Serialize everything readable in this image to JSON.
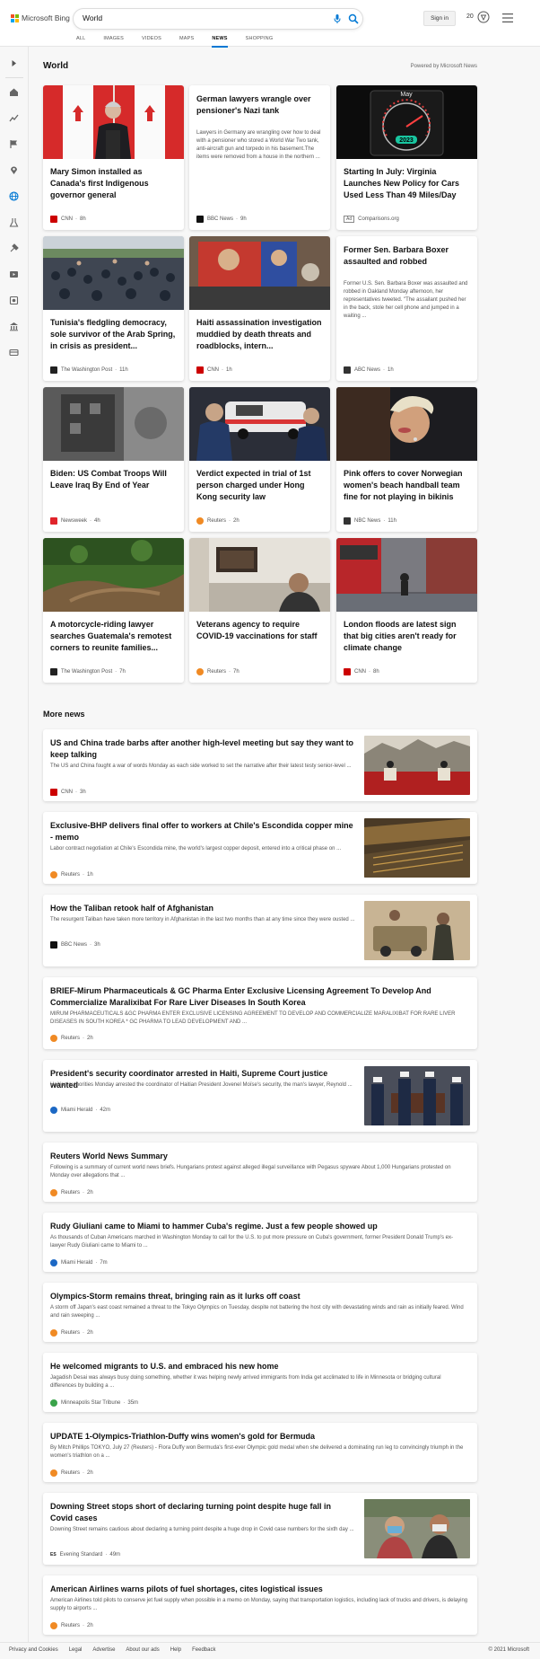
{
  "header": {
    "logo_text": "Microsoft Bing",
    "search_value": "World",
    "signin_label": "Sign in",
    "rewards_points": "20",
    "logo_colors": [
      "#f25022",
      "#7fba00",
      "#00a4ef",
      "#ffb900"
    ]
  },
  "nav": {
    "tabs": [
      {
        "label": "ALL"
      },
      {
        "label": "IMAGES"
      },
      {
        "label": "VIDEOS"
      },
      {
        "label": "MAPS"
      },
      {
        "label": "NEWS",
        "active": true
      },
      {
        "label": "SHOPPING"
      }
    ]
  },
  "sidebar": {
    "icons": [
      "expand-icon",
      "home-icon",
      "trending-icon",
      "flag-icon",
      "location-icon",
      "globe-icon",
      "science-icon",
      "technology-icon",
      "entertainment-icon",
      "sports-icon",
      "business-icon",
      "politics-icon"
    ]
  },
  "world": {
    "title": "World",
    "powered_by": "Powered by Microsoft News",
    "cards": [
      {
        "title": "Mary Simon installed as Canada's first Indigenous governor general",
        "source": "CNN",
        "time": "8h",
        "logo_color": "#cc0000"
      },
      {
        "title": "German lawyers wrangle over pensioner's Nazi tank",
        "snippet": "Lawyers in Germany are wrangling over how to deal with a pensioner who stored a World War Two tank, anti-aircraft gun and torpedo in his basement.The items were removed from a house in the northern ...",
        "source": "BBC News",
        "time": "9h",
        "logo_color": "#111111"
      },
      {
        "title": "Starting In July: Virginia Launches New Policy for Cars Used Less Than 49 Miles/Day",
        "source": "Comparisons.org",
        "time": "",
        "ad": "Ad",
        "image_month": "May",
        "image_year": "2023"
      },
      {
        "title": "Tunisia's fledgling democracy, sole survivor of the Arab Spring, in crisis as president...",
        "source": "The Washington Post",
        "time": "11h",
        "logo_color": "#222222"
      },
      {
        "title": "Haiti assassination investigation muddied by death threats and roadblocks, intern...",
        "source": "CNN",
        "time": "1h",
        "logo_color": "#cc0000"
      },
      {
        "title": "Former Sen. Barbara Boxer assaulted and robbed",
        "snippet": "Former U.S. Sen. Barbara Boxer was assaulted and robbed in Oakland Monday afternoon, her representatives tweeted. \"The assailant pushed her in the back, stole her cell phone and jumped in a waiting ...",
        "source": "ABC News",
        "time": "1h",
        "logo_color": "#333333"
      },
      {
        "title": "Biden: US Combat Troops Will Leave Iraq By End of Year",
        "source": "Newsweek",
        "time": "4h",
        "logo_color": "#e0242b"
      },
      {
        "title": "Verdict expected in trial of 1st person charged under Hong Kong security law",
        "source": "Reuters",
        "time": "2h",
        "logo_color": "#f08a24"
      },
      {
        "title": "Pink offers to cover Norwegian women's beach handball team fine for not playing in bikinis",
        "source": "NBC News",
        "time": "11h",
        "logo_color": "#333333"
      },
      {
        "title": "A motorcycle-riding lawyer searches Guatemala's remotest corners to reunite families...",
        "source": "The Washington Post",
        "time": "7h",
        "logo_color": "#222222"
      },
      {
        "title": "Veterans agency to require COVID-19 vaccinations for staff",
        "source": "Reuters",
        "time": "7h",
        "logo_color": "#f08a24"
      },
      {
        "title": "London floods are latest sign that big cities aren't ready for climate change",
        "source": "CNN",
        "time": "8h",
        "logo_color": "#cc0000"
      }
    ]
  },
  "more_news": {
    "title": "More news",
    "items": [
      {
        "title": "US and China trade barbs after another high-level meeting but say they want to keep talking",
        "snippet": "The US and China fought a war of words Monday as each side worked to set the narrative after their latest testy senior-level ...",
        "source": "CNN",
        "time": "3h",
        "logo_color": "#cc0000",
        "has_image": true
      },
      {
        "title": "Exclusive-BHP delivers final offer to workers at Chile's Escondida copper mine - memo",
        "snippet": "Labor contract negotiation at Chile's Escondida mine, the world's largest copper deposit, entered into a critical phase on ...",
        "source": "Reuters",
        "time": "1h",
        "logo_color": "#f08a24",
        "has_image": true
      },
      {
        "title": "How the Taliban retook half of Afghanistan",
        "snippet": "The resurgent Taliban have taken more territory in Afghanistan in the last two months than at any time since they were ousted ...",
        "source": "BBC News",
        "time": "3h",
        "logo_color": "#111111",
        "has_image": true
      },
      {
        "title": "BRIEF-Mirum Pharmaceuticals & GC Pharma Enter Exclusive Licensing Agreement To Develop And Commercialize Maralixibat For Rare Liver Diseases In South Korea",
        "snippet": "MIRUM PHARMACEUTICALS &GC PHARMA ENTER EXCLUSIVE LICENSING AGREEMENT TO DEVELOP AND COMMERCIALIZE MARALIXIBAT FOR RARE LIVER DISEASES IN SOUTH KOREA * GC PHARMA TO LEAD DEVELOPMENT AND ...",
        "source": "Reuters",
        "time": "2h",
        "logo_color": "#f08a24",
        "has_image": false
      },
      {
        "title": "President's security coordinator arrested in Haiti, Supreme Court justice wanted",
        "snippet": "Haitian authorities Monday arrested the coordinator of Haitian President Jovenel Moïse's security, the man's lawyer, Reynold ...",
        "source": "Miami Herald",
        "time": "42m",
        "logo_color": "#1c68c4",
        "has_image": true
      },
      {
        "title": "Reuters World News Summary",
        "snippet": "Following is a summary of current world news briefs. Hungarians protest against alleged illegal surveillance with Pegasus spyware About 1,000 Hungarians protested on Monday over allegations that ...",
        "source": "Reuters",
        "time": "2h",
        "logo_color": "#f08a24",
        "has_image": false
      },
      {
        "title": "Rudy Giuliani came to Miami to hammer Cuba's regime. Just a few people showed up",
        "snippet": "As thousands of Cuban Americans marched in Washington Monday to call for the U.S. to put more pressure on Cuba's government, former President Donald Trump's ex-lawyer Rudy Giuliani came to Miami to ...",
        "source": "Miami Herald",
        "time": "7m",
        "logo_color": "#1c68c4",
        "has_image": false
      },
      {
        "title": "Olympics-Storm remains threat, bringing rain as it lurks off coast",
        "snippet": "A storm off Japan's east coast remained a threat to the Tokyo Olympics on Tuesday, despite not battering the host city with devastating winds and rain as initially feared. Wind and rain sweeping ...",
        "source": "Reuters",
        "time": "2h",
        "logo_color": "#f08a24",
        "has_image": false
      },
      {
        "title": "He welcomed migrants to U.S. and embraced his new home",
        "snippet": "Jagadish Desai was always busy doing something, whether it was helping newly arrived immigrants from India get acclimated to life in Minnesota or bridging cultural differences by building a ...",
        "source": "Minneapolis Star Tribune",
        "time": "35m",
        "logo_color": "#3aa34a",
        "has_image": false
      },
      {
        "title": "UPDATE 1-Olympics-Triathlon-Duffy wins women's gold for Bermuda",
        "snippet": "By Mitch Phillips TOKYO, July 27 (Reuters) - Flora Duffy won Bermuda's first-ever Olympic gold medal when she delivered a dominating run leg to convincingly triumph in the women's triathlon on a ...",
        "source": "Reuters",
        "time": "2h",
        "logo_color": "#f08a24",
        "has_image": false
      },
      {
        "title": "Downing Street stops short of declaring turning point despite huge fall in Covid cases",
        "snippet": "Downing Street remains cautious about declaring a turning point despite a huge drop in Covid case numbers for the sixth day ...",
        "source": "Evening Standard",
        "time": "49m",
        "logo_color": "#222222",
        "logo_text": "ES",
        "has_image": true
      },
      {
        "title": "American Airlines warns pilots of fuel shortages, cites logistical issues",
        "snippet": "American Airlines told pilots to conserve jet fuel supply when possible in a memo on Monday, saying that transportation logistics, including lack of trucks and drivers, is delaying supply to airports ...",
        "source": "Reuters",
        "time": "2h",
        "logo_color": "#f08a24",
        "has_image": false
      }
    ]
  },
  "footer": {
    "links": [
      "Privacy and Cookies",
      "Legal",
      "Advertise",
      "About our ads",
      "Help",
      "Feedback"
    ],
    "copyright": "© 2021 Microsoft"
  }
}
